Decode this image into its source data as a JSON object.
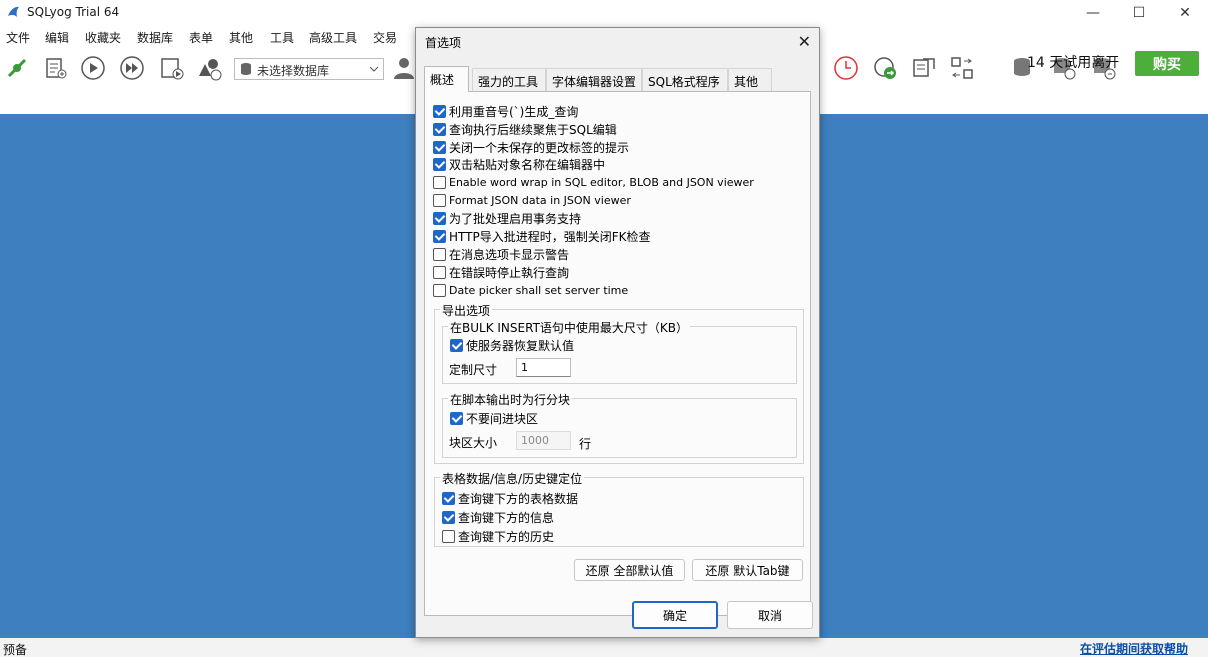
{
  "window": {
    "title": "SQLyog Trial 64",
    "minimize": "—",
    "maximize": "☐",
    "close": "✕"
  },
  "menu": [
    "文件",
    "编辑",
    "收藏夹",
    "数据库",
    "表单",
    "其他",
    "工具",
    "高级工具",
    "交易"
  ],
  "toolbar": {
    "db_select": "未选择数据库",
    "trial_text": "14 天试用离开",
    "buy_label": "购买"
  },
  "status": {
    "left": "预备",
    "right": "在评估期间获取帮助"
  },
  "dialog": {
    "title": "首选项",
    "tabs": [
      "概述",
      "强力的工具",
      "字体编辑器设置",
      "SQL格式程序",
      "其他"
    ],
    "checkboxes": [
      {
        "label": "利用重音号(`)生成_查询",
        "checked": true
      },
      {
        "label": "查询执行后继续聚焦于SQL编辑",
        "checked": true
      },
      {
        "label": "关闭一个未保存的更改标签的提示",
        "checked": true
      },
      {
        "label": "双击粘贴对象名称在编辑器中",
        "checked": true
      },
      {
        "label": "Enable word wrap in SQL editor, BLOB and JSON viewer",
        "checked": false
      },
      {
        "label": "Format JSON data in JSON viewer",
        "checked": false
      },
      {
        "label": "为了批处理启用事务支持",
        "checked": true
      },
      {
        "label": "HTTP导入批进程时，强制关闭FK检查",
        "checked": true
      },
      {
        "label": "在消息选项卡显示警告",
        "checked": false
      },
      {
        "label": "在错誤時停止執行查詢",
        "checked": false
      },
      {
        "label": "Date picker shall set server time",
        "checked": false
      }
    ],
    "export": {
      "title": "导出选项",
      "bulk": {
        "title": "在BULK INSERT语句中使用最大尺寸（KB）",
        "use_server_default": "使服务器恢复默认值",
        "use_server_default_checked": true,
        "custom_label": "定制尺寸",
        "custom_value": "1"
      },
      "chunk": {
        "title": "在脚本输出时为行分块",
        "no_chunk": "不要间进块区",
        "no_chunk_checked": true,
        "size_label": "块区大小",
        "size_value": "1000",
        "unit": "行"
      }
    },
    "tabkey": {
      "title": "表格数据/信息/历史键定位",
      "items": [
        {
          "label": "查询键下方的表格数据",
          "checked": true
        },
        {
          "label": "查询键下方的信息",
          "checked": true
        },
        {
          "label": "查询键下方的历史",
          "checked": false
        }
      ]
    },
    "buttons": {
      "restore_all": "还原 全部默认值",
      "restore_tab": "还原 默认Tab键",
      "ok": "确定",
      "cancel": "取消"
    }
  }
}
